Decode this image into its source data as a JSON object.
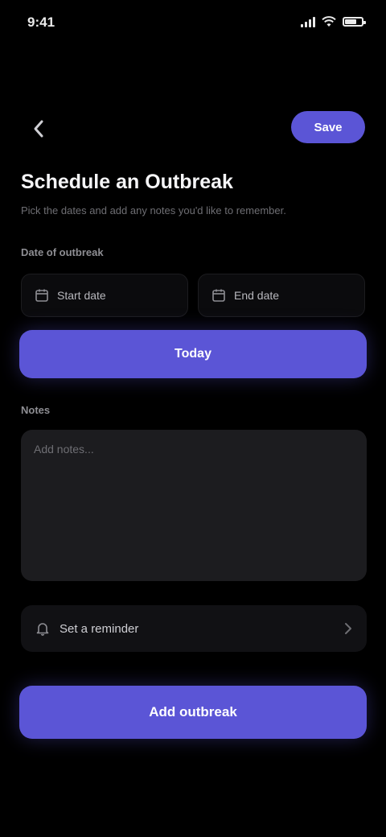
{
  "status_bar": {
    "time": "9:41",
    "battery_level": 0.8
  },
  "nav": {
    "back_icon": "chevron-left-icon",
    "save_label": "Save"
  },
  "header": {
    "title": "Schedule an Outbreak",
    "subtitle": "Pick the dates and add any notes you'd like to remember."
  },
  "dates": {
    "label": "Date of outbreak",
    "start": {
      "icon": "calendar-icon",
      "value": "Start date"
    },
    "end": {
      "icon": "calendar-icon",
      "value": "End date"
    }
  },
  "today_button": {
    "label": "Today"
  },
  "notes": {
    "label": "Notes",
    "placeholder": "Add notes..."
  },
  "reminder": {
    "icon": "bell-icon",
    "label": "Set a reminder"
  },
  "add_button": {
    "label": "Add outbreak"
  },
  "colors": {
    "accent": "#5b55d6",
    "background": "#000000",
    "surface": "#1c1c1f"
  }
}
